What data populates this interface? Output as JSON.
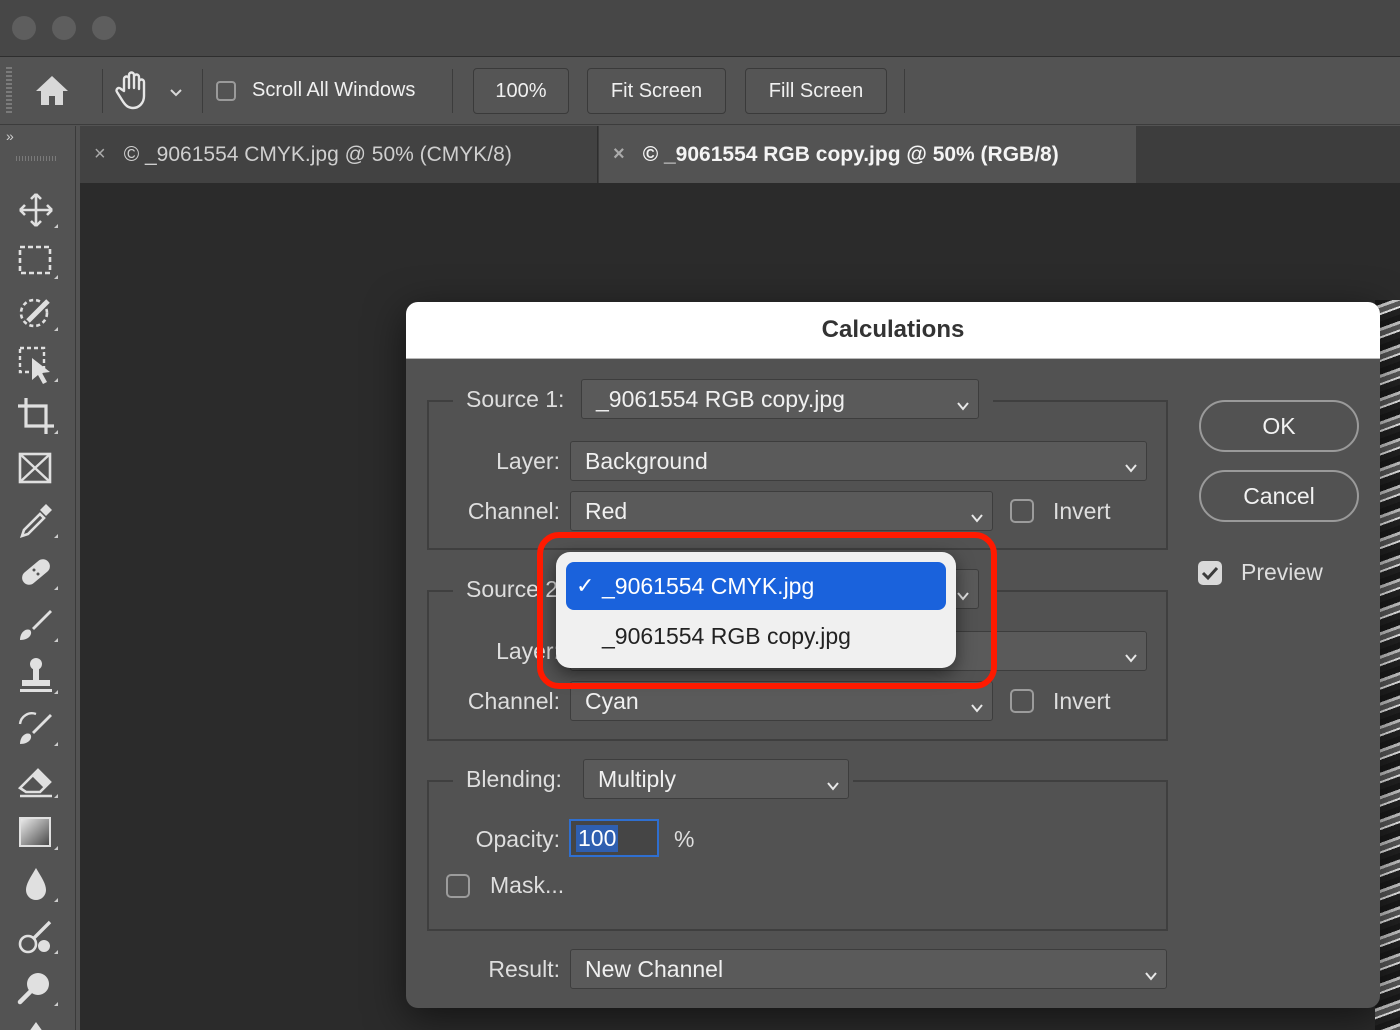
{
  "options_bar": {
    "scroll_all_windows": "Scroll All Windows",
    "zoom_100": "100%",
    "fit_screen": "Fit Screen",
    "fill_screen": "Fill Screen"
  },
  "tabs": [
    {
      "close": "×",
      "label": "© _9061554 CMYK.jpg @ 50% (CMYK/8)"
    },
    {
      "close": "×",
      "label": "© _9061554 RGB copy.jpg @ 50% (RGB/8)"
    }
  ],
  "toolbar": {
    "collapse": "»",
    "tools": [
      "move-tool",
      "marquee-tool",
      "quick-selection-tool",
      "object-selection-tool",
      "crop-tool",
      "frame-tool",
      "eyedropper-tool",
      "healing-brush-tool",
      "brush-tool",
      "clone-stamp-tool",
      "history-brush-tool",
      "eraser-tool",
      "gradient-tool",
      "blur-tool",
      "dodge-tool",
      "pen-tool"
    ]
  },
  "dialog": {
    "title": "Calculations",
    "source1": {
      "label": "Source 1:",
      "value": "_9061554 RGB copy.jpg",
      "layer_label": "Layer:",
      "layer_value": "Background",
      "channel_label": "Channel:",
      "channel_value": "Red",
      "invert_label": "Invert"
    },
    "source2": {
      "label": "Source 2:",
      "layer_label": "Layer:",
      "channel_label": "Channel:",
      "channel_value": "Cyan",
      "invert_label": "Invert"
    },
    "blending": {
      "label": "Blending:",
      "value": "Multiply",
      "opacity_label": "Opacity:",
      "opacity_value": "100",
      "opacity_unit": "%",
      "mask_label": "Mask..."
    },
    "result": {
      "label": "Result:",
      "value": "New Channel"
    },
    "ok": "OK",
    "cancel": "Cancel",
    "preview": "Preview"
  },
  "popup": {
    "items": [
      {
        "check": "✓",
        "label": "_9061554 CMYK.jpg",
        "selected": true
      },
      {
        "label": "_9061554 RGB copy.jpg",
        "selected": false
      }
    ]
  },
  "colors": {
    "selection": "#1a62dc",
    "highlight": "#ff1a00"
  }
}
